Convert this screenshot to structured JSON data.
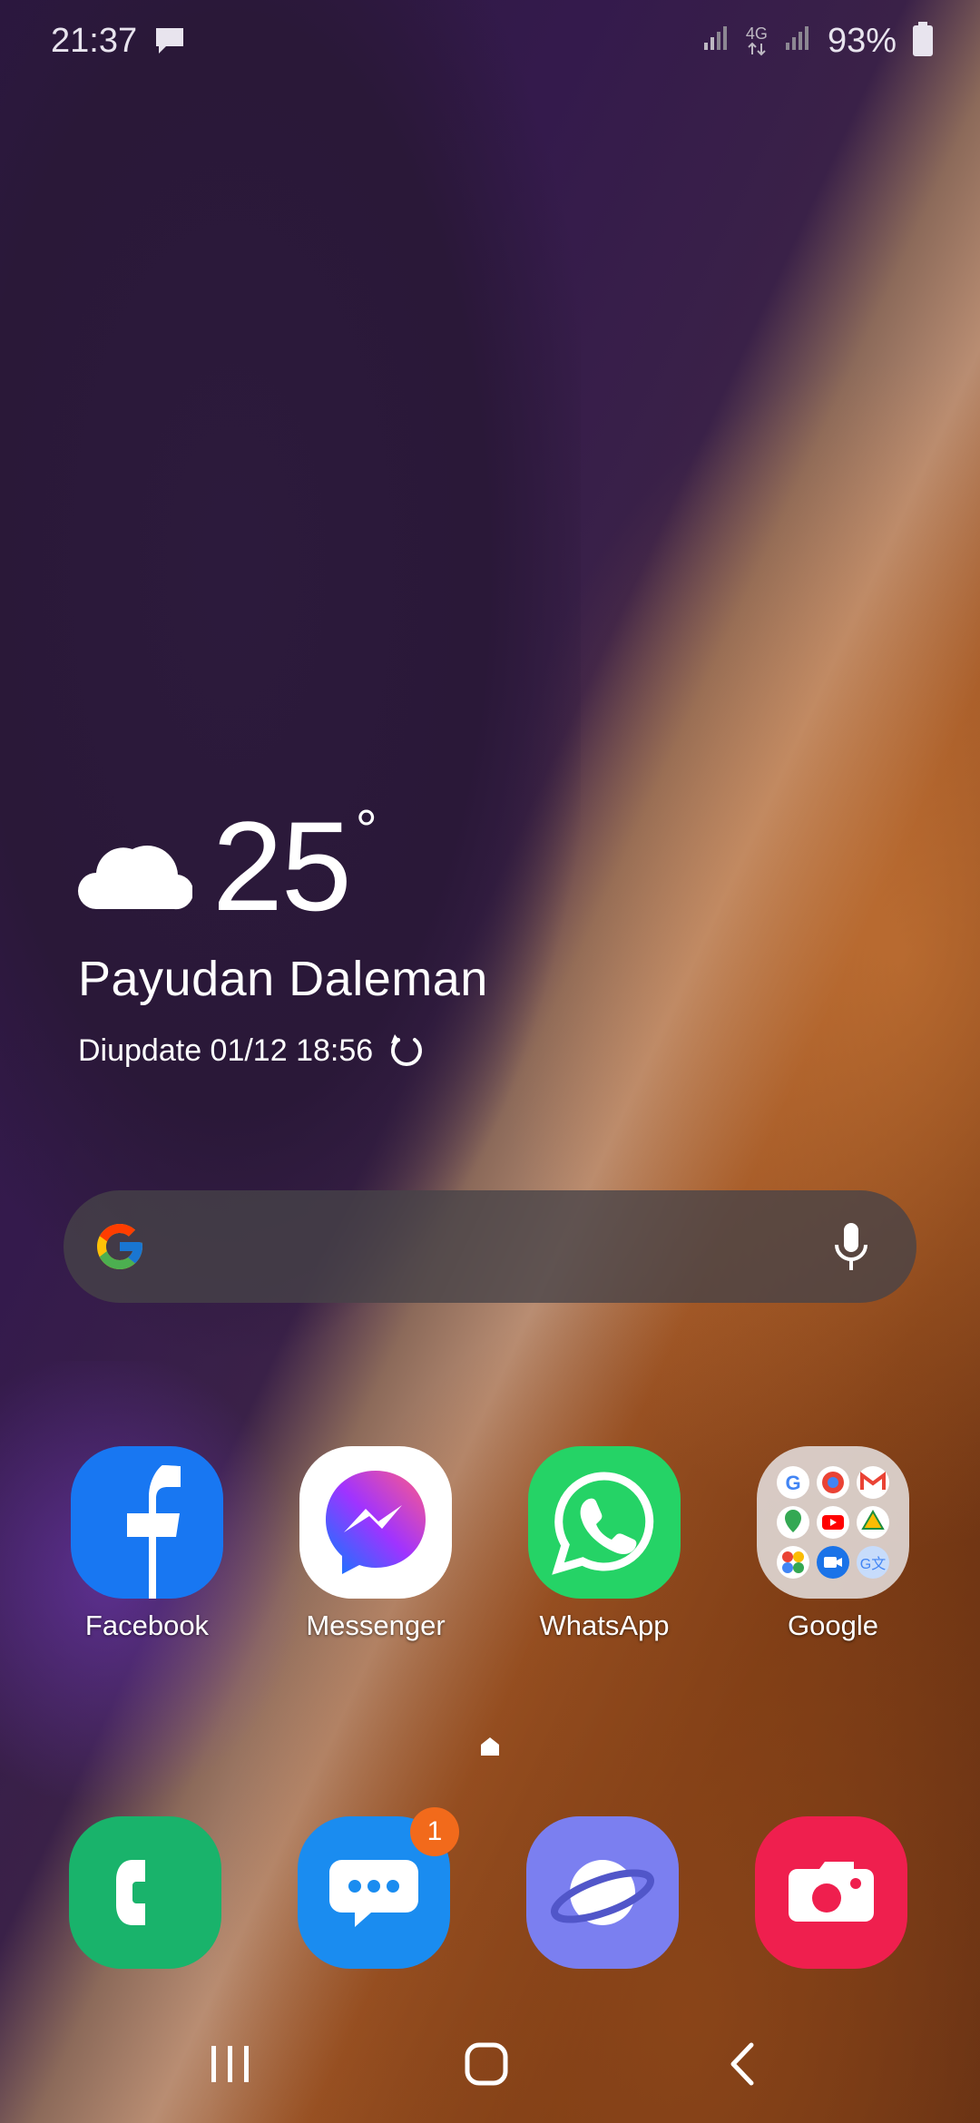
{
  "status_bar": {
    "time": "21:37",
    "network_label": "4G",
    "battery_percent": "93%",
    "icons": [
      "message-icon",
      "signal-icon",
      "4g-icon",
      "signal-icon",
      "battery-icon"
    ]
  },
  "weather": {
    "temperature": "25",
    "unit": "°",
    "location": "Payudan Daleman",
    "updated": "Diupdate 01/12 18:56",
    "icon": "cloud-icon"
  },
  "search": {
    "icon": "google-logo",
    "voice_icon": "mic-icon"
  },
  "apps": [
    {
      "label": "Facebook",
      "icon": "facebook-icon",
      "color": "#1877F2"
    },
    {
      "label": "Messenger",
      "icon": "messenger-icon",
      "color": "#ffffff"
    },
    {
      "label": "WhatsApp",
      "icon": "whatsapp-icon",
      "color": "#25D366"
    },
    {
      "label": "Google",
      "icon": "google-folder-icon",
      "color": "#d8d2cf"
    }
  ],
  "dock": [
    {
      "icon": "phone-icon",
      "color": "#19b36b"
    },
    {
      "icon": "messages-icon",
      "color": "#1a8cf0",
      "badge": "1"
    },
    {
      "icon": "internet-icon",
      "color": "#7b7ff0"
    },
    {
      "icon": "camera-icon",
      "color": "#ef1f4e"
    }
  ],
  "nav": {
    "icons": [
      "recents-icon",
      "home-icon",
      "back-icon"
    ]
  },
  "colors": {
    "badge": "#f26a1b",
    "search_bg": "#46424899"
  }
}
